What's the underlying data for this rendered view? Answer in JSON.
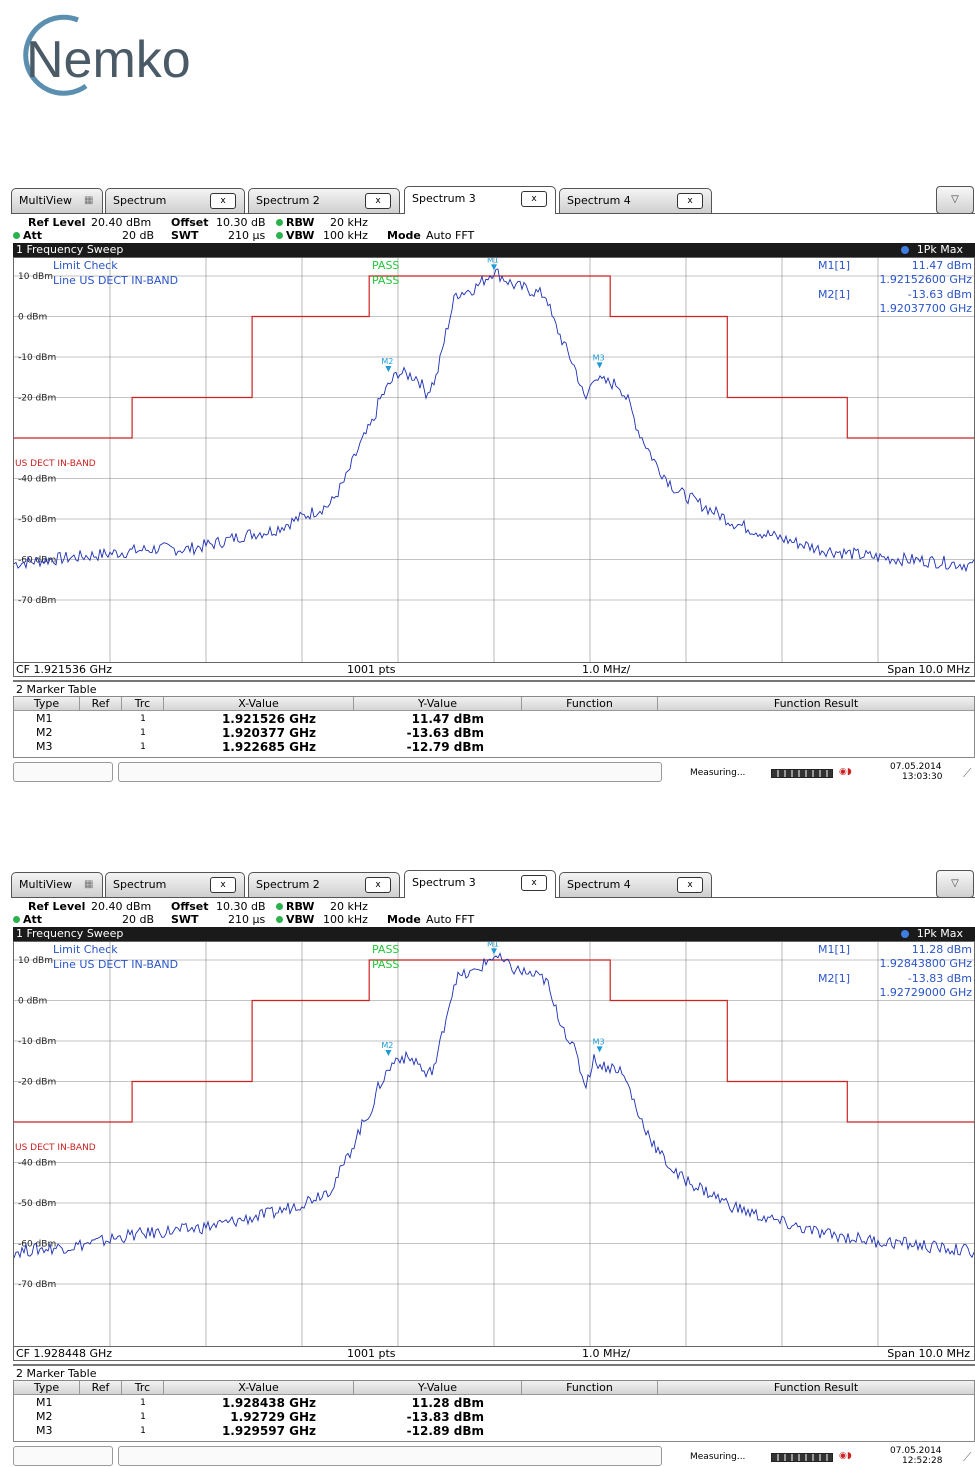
{
  "logo": {
    "text": "Nemko",
    "color": "#4a5a66",
    "ring_color": "#5b8fb0"
  },
  "colors": {
    "trace": "#1c2fb5",
    "limit": "#cc2222",
    "marker": "#1d9ad6",
    "grid": "#888888"
  },
  "tabs": [
    {
      "label": "MultiView"
    },
    {
      "label": "Spectrum",
      "close": "x"
    },
    {
      "label": "Spectrum 2",
      "close": "x"
    },
    {
      "label": "Spectrum 3",
      "close": "x",
      "active": true
    },
    {
      "label": "Spectrum 4",
      "close": "x"
    }
  ],
  "dropdown_icon": "▽",
  "settings": {
    "ref_level_label": "Ref Level",
    "ref_level": "20.40 dBm",
    "offset_label": "Offset",
    "offset": "10.30 dB",
    "rbw_label": "RBW",
    "rbw": "20 kHz",
    "att_label": "Att",
    "att": "20 dB",
    "swt_label": "SWT",
    "swt": "210 µs",
    "vbw_label": "VBW",
    "vbw": "100 kHz",
    "mode_label": "Mode",
    "mode": "Auto FFT"
  },
  "sweep": {
    "title": "1 Frequency Sweep",
    "trace": "1Pk Max"
  },
  "limit": {
    "check": "Limit Check",
    "line": "Line US DECT IN-BAND",
    "pass1": "PASS",
    "pass2": "PASS",
    "label": "US DECT IN-BAND"
  },
  "y_labels": [
    "10 dBm",
    "0 dBm",
    "-10 dBm",
    "-20 dBm",
    "",
    "-40 dBm",
    "-50 dBm",
    "-60 dBm",
    "-70 dBm"
  ],
  "table_headers": [
    "Type",
    "Ref",
    "Trc",
    "X-Value",
    "Y-Value",
    "Function",
    "Function Result"
  ],
  "marker_table_title": "2 Marker Table",
  "points": "1001 pts",
  "div": "1.0 MHz/",
  "measuring": "Measuring...",
  "panels": [
    {
      "cf": "CF 1.921536 GHz",
      "span": "Span 10.0 MHz",
      "m1_label": "M1[1]",
      "m1_y": "11.47 dBm",
      "m1_x": "1.92152600 GHz",
      "m2_label": "M2[1]",
      "m2_y": "-13.63 dBm",
      "m2_x": "1.92037700 GHz",
      "rows": [
        {
          "type": "M1",
          "ref": "",
          "trc": "1",
          "x": "1.921526 GHz",
          "y": "11.47 dBm"
        },
        {
          "type": "M2",
          "ref": "",
          "trc": "1",
          "x": "1.920377 GHz",
          "y": "-13.63 dBm"
        },
        {
          "type": "M3",
          "ref": "",
          "trc": "1",
          "x": "1.922685 GHz",
          "y": "-12.79 dBm"
        }
      ],
      "date": "07.05.2014",
      "time": "13:03:30",
      "trace_points": [
        [
          0,
          -61
        ],
        [
          0.3,
          -60.2
        ],
        [
          0.6,
          -59.5
        ],
        [
          0.9,
          -58.8
        ],
        [
          1.2,
          -58
        ],
        [
          1.5,
          -57.3
        ],
        [
          1.8,
          -57.5
        ],
        [
          2.1,
          -56
        ],
        [
          2.4,
          -54
        ],
        [
          2.7,
          -52.8
        ],
        [
          3.0,
          -49.5
        ],
        [
          3.3,
          -46.3
        ],
        [
          3.45,
          -40.3
        ],
        [
          3.6,
          -32
        ],
        [
          3.75,
          -25.5
        ],
        [
          3.8,
          -21
        ],
        [
          3.9,
          -17.2
        ],
        [
          4.0,
          -13.8
        ],
        [
          4.2,
          -15
        ],
        [
          4.3,
          -19
        ],
        [
          4.4,
          -15
        ],
        [
          4.5,
          -4
        ],
        [
          4.6,
          5.5
        ],
        [
          4.8,
          7
        ],
        [
          5.0,
          11.3
        ],
        [
          5.2,
          7.8
        ],
        [
          5.4,
          6.3
        ],
        [
          5.55,
          5
        ],
        [
          5.6,
          0
        ],
        [
          5.75,
          -8
        ],
        [
          5.85,
          -13
        ],
        [
          5.95,
          -21
        ],
        [
          6.05,
          -14
        ],
        [
          6.1,
          -16
        ],
        [
          6.3,
          -16.8
        ],
        [
          6.4,
          -21
        ],
        [
          6.5,
          -28
        ],
        [
          6.7,
          -37
        ],
        [
          6.9,
          -43
        ],
        [
          7.2,
          -47
        ],
        [
          7.5,
          -51
        ],
        [
          7.8,
          -53.5
        ],
        [
          8.1,
          -55.5
        ],
        [
          8.4,
          -57.5
        ],
        [
          8.7,
          -58.5
        ],
        [
          9.0,
          -59.5
        ],
        [
          9.3,
          -60
        ],
        [
          9.6,
          -60.5
        ],
        [
          10,
          -61.5
        ]
      ]
    },
    {
      "cf": "CF 1.928448 GHz",
      "span": "Span 10.0 MHz",
      "m1_label": "M1[1]",
      "m1_y": "11.28 dBm",
      "m1_x": "1.92843800 GHz",
      "m2_label": "M2[1]",
      "m2_y": "-13.83 dBm",
      "m2_x": "1.92729000 GHz",
      "rows": [
        {
          "type": "M1",
          "ref": "",
          "trc": "1",
          "x": "1.928438 GHz",
          "y": "11.28 dBm"
        },
        {
          "type": "M2",
          "ref": "",
          "trc": "1",
          "x": "1.92729 GHz",
          "y": "-13.83 dBm"
        },
        {
          "type": "M3",
          "ref": "",
          "trc": "1",
          "x": "1.929597 GHz",
          "y": "-12.89 dBm"
        }
      ],
      "date": "07.05.2014",
      "time": "12:52:28",
      "trace_points": [
        [
          0,
          -62
        ],
        [
          0.3,
          -61.3
        ],
        [
          0.6,
          -60.7
        ],
        [
          0.9,
          -59.5
        ],
        [
          1.2,
          -58
        ],
        [
          1.5,
          -57.2
        ],
        [
          1.8,
          -56.6
        ],
        [
          2.1,
          -55.5
        ],
        [
          2.4,
          -54
        ],
        [
          2.7,
          -52.5
        ],
        [
          3.0,
          -50
        ],
        [
          3.3,
          -46.5
        ],
        [
          3.45,
          -40
        ],
        [
          3.6,
          -32
        ],
        [
          3.75,
          -25.5
        ],
        [
          3.8,
          -21
        ],
        [
          3.9,
          -17.2
        ],
        [
          4.0,
          -13.8
        ],
        [
          4.2,
          -15
        ],
        [
          4.3,
          -19
        ],
        [
          4.4,
          -15
        ],
        [
          4.5,
          -4
        ],
        [
          4.6,
          5.5
        ],
        [
          4.8,
          7
        ],
        [
          5.0,
          11.1
        ],
        [
          5.2,
          7.8
        ],
        [
          5.4,
          6.3
        ],
        [
          5.55,
          5
        ],
        [
          5.6,
          0
        ],
        [
          5.75,
          -8
        ],
        [
          5.85,
          -13
        ],
        [
          5.95,
          -21
        ],
        [
          6.05,
          -14
        ],
        [
          6.1,
          -16
        ],
        [
          6.3,
          -16.8
        ],
        [
          6.4,
          -21
        ],
        [
          6.5,
          -28
        ],
        [
          6.7,
          -37
        ],
        [
          6.9,
          -43
        ],
        [
          7.2,
          -47
        ],
        [
          7.5,
          -51
        ],
        [
          7.8,
          -53.5
        ],
        [
          8.1,
          -55.5
        ],
        [
          8.4,
          -57.5
        ],
        [
          8.7,
          -58.5
        ],
        [
          9.0,
          -59.5
        ],
        [
          9.3,
          -60
        ],
        [
          9.6,
          -61
        ],
        [
          10,
          -62
        ]
      ]
    }
  ],
  "limit_line": [
    [
      0,
      -30
    ],
    [
      1.23,
      -30
    ],
    [
      1.23,
      -20
    ],
    [
      2.48,
      -20
    ],
    [
      2.48,
      0
    ],
    [
      3.7,
      0
    ],
    [
      3.7,
      10
    ],
    [
      6.21,
      10
    ],
    [
      6.21,
      0
    ],
    [
      7.43,
      0
    ],
    [
      7.43,
      -20
    ],
    [
      8.68,
      -20
    ],
    [
      8.68,
      -30
    ],
    [
      10,
      -30
    ]
  ],
  "markers": [
    {
      "name": "M1",
      "x": 5.0,
      "y": 11.4
    },
    {
      "name": "M2",
      "x": 3.9,
      "y": -13.7
    },
    {
      "name": "M3",
      "x": 6.1,
      "y": -12.8
    }
  ]
}
